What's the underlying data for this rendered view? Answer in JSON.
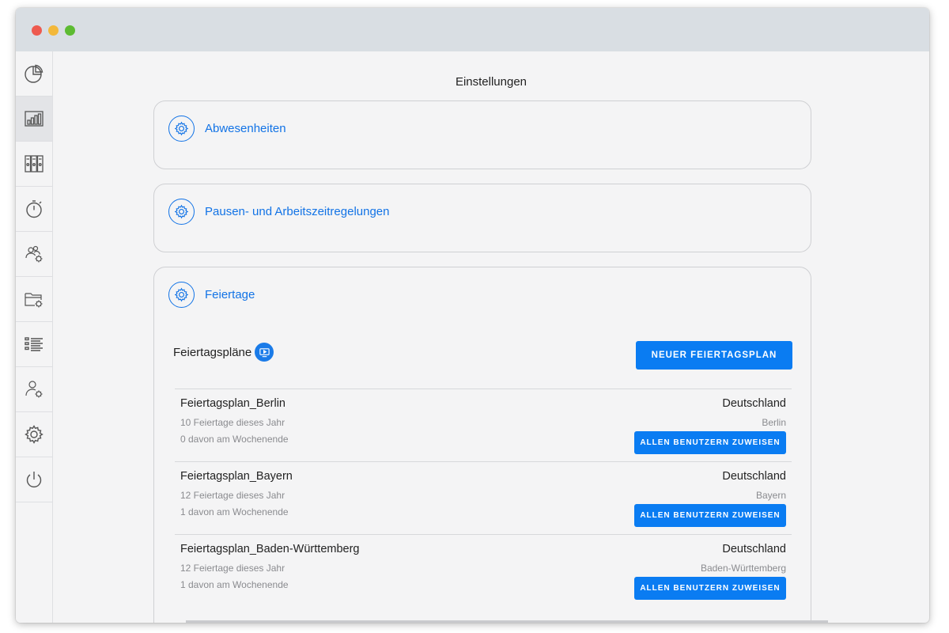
{
  "window": {
    "traffic_lights": [
      "close",
      "minimize",
      "zoom"
    ]
  },
  "sidebar": {
    "items": [
      {
        "icon": "pie-chart-icon",
        "active": false
      },
      {
        "icon": "bar-chart-icon",
        "active": true
      },
      {
        "icon": "binders-icon",
        "active": false
      },
      {
        "icon": "stopwatch-icon",
        "active": false
      },
      {
        "icon": "team-settings-icon",
        "active": false
      },
      {
        "icon": "folder-settings-icon",
        "active": false
      },
      {
        "icon": "list-icon",
        "active": false
      },
      {
        "icon": "user-settings-icon",
        "active": false
      },
      {
        "icon": "gear-icon",
        "active": false
      },
      {
        "icon": "power-icon",
        "active": false
      }
    ]
  },
  "page": {
    "title": "Einstellungen"
  },
  "sections": [
    {
      "title": "Abwesenheiten"
    },
    {
      "title": "Pausen- und Arbeitszeitregelungen"
    },
    {
      "title": "Feiertage"
    }
  ],
  "holidays": {
    "label": "Feiertagspläne",
    "new_button": "NEUER FEIERTAGSPLAN",
    "plans": [
      {
        "name": "Feiertagsplan_Berlin",
        "count": "10 Feiertage dieses Jahr",
        "weekend": "0 davon am Wochenende",
        "country": "Deutschland",
        "region": "Berlin",
        "button": "ALLEN BENUTZERN ZUWEISEN"
      },
      {
        "name": "Feiertagsplan_Bayern",
        "count": "12 Feiertage dieses Jahr",
        "weekend": "1 davon am Wochenende",
        "country": "Deutschland",
        "region": "Bayern",
        "button": "ALLEN BENUTZERN ZUWEISEN"
      },
      {
        "name": "Feiertagsplan_Baden-Württemberg",
        "count": "12 Feiertage dieses Jahr",
        "weekend": "1 davon am Wochenende",
        "country": "Deutschland",
        "region": "Baden-Württemberg",
        "button": "ALLEN BENUTZERN ZUWEISEN"
      }
    ]
  },
  "colors": {
    "accent": "#1273e6",
    "button": "#0a7cf2"
  }
}
